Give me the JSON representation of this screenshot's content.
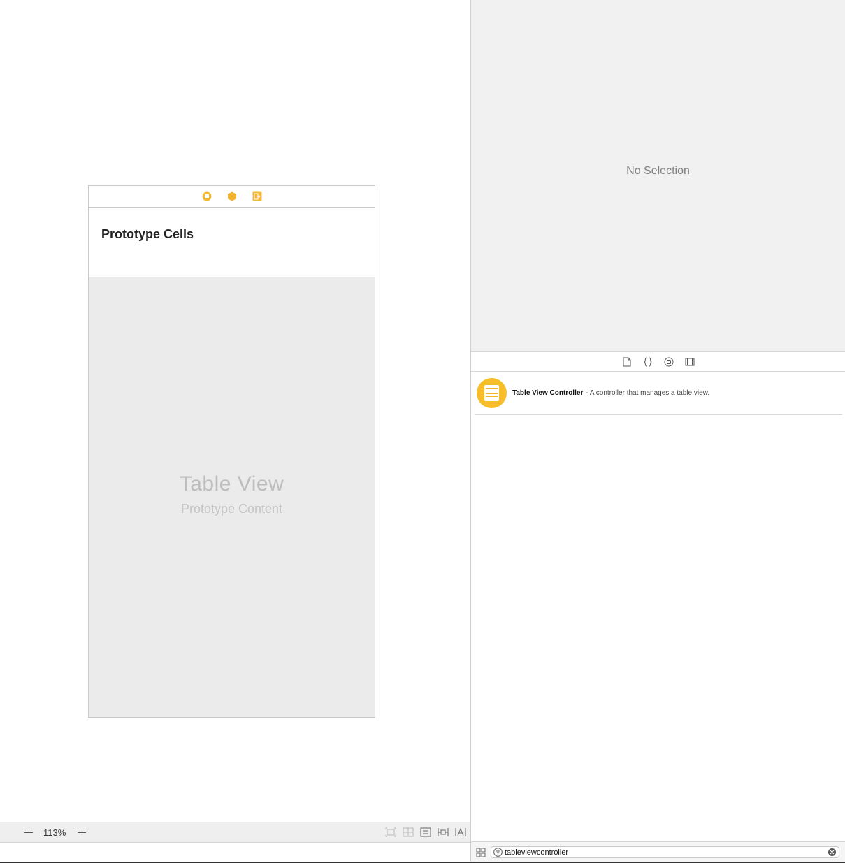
{
  "canvas": {
    "scene": {
      "dock_icons": [
        "view-controller-icon",
        "first-responder-icon",
        "exit-icon"
      ],
      "prototype_header": "Prototype Cells",
      "placeholder_title": "Table View",
      "placeholder_subtitle": "Prototype Content"
    },
    "bar": {
      "zoom_level": "113%",
      "tools": [
        "update-frames-icon",
        "embed-in-stack-icon",
        "align-icon",
        "add-constraints-icon",
        "resolve-issues-icon"
      ]
    }
  },
  "inspector": {
    "empty_text": "No Selection"
  },
  "library": {
    "tabs": [
      "file-template-icon",
      "code-snippet-icon",
      "object-library-icon",
      "media-library-icon"
    ],
    "items": [
      {
        "name": "Table View Controller",
        "description": "- A controller that manages a table view.",
        "icon": "table-view-controller-icon",
        "icon_color": "#f7bd2a"
      }
    ],
    "filter": {
      "value": "tableviewcontroller"
    }
  }
}
